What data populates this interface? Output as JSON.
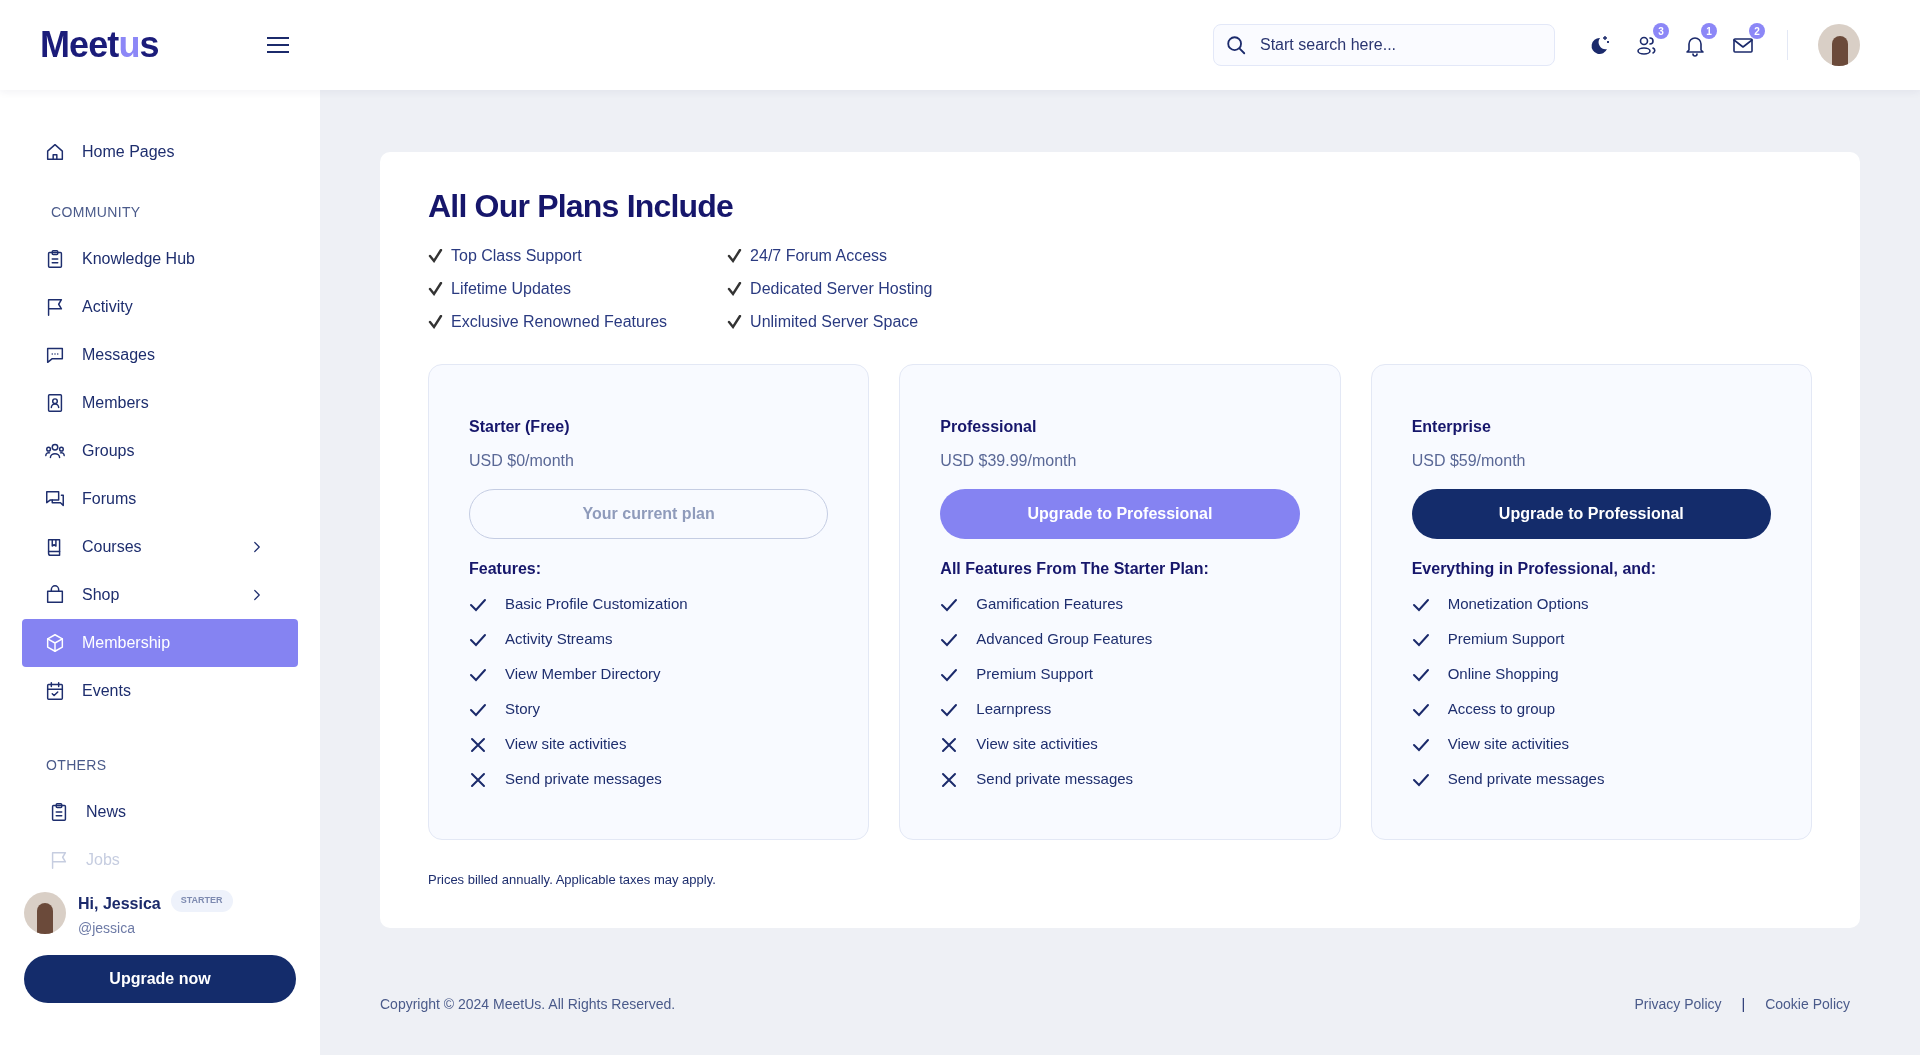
{
  "header": {
    "logo": [
      {
        "text": "Meet",
        "accent": false
      },
      {
        "text": "u",
        "accent": true
      },
      {
        "text": "s",
        "accent": false
      }
    ],
    "search": {
      "placeholder": "Start search here..."
    },
    "icons": [
      {
        "kind": "theme"
      },
      {
        "kind": "friends",
        "badge": "3"
      },
      {
        "kind": "notifications",
        "badge": "1"
      },
      {
        "kind": "messages",
        "badge": "2"
      }
    ]
  },
  "sidebar": {
    "top_items": [
      {
        "label": "Home Pages",
        "selected": false,
        "has_submenu": false
      }
    ],
    "community_heading": "COMMUNITY",
    "community_items": [
      {
        "label": "Knowledge Hub",
        "selected": false,
        "has_submenu": false
      },
      {
        "label": "Activity",
        "selected": false,
        "has_submenu": false
      },
      {
        "label": "Messages",
        "selected": false,
        "has_submenu": false
      },
      {
        "label": "Members",
        "selected": false,
        "has_submenu": false
      },
      {
        "label": "Groups",
        "selected": false,
        "has_submenu": false
      },
      {
        "label": "Forums",
        "selected": false,
        "has_submenu": false
      },
      {
        "label": "Courses",
        "selected": false,
        "has_submenu": true
      },
      {
        "label": "Shop",
        "selected": false,
        "has_submenu": true
      },
      {
        "label": "Membership",
        "selected": true,
        "has_submenu": false
      },
      {
        "label": "Events",
        "selected": false,
        "has_submenu": false
      }
    ],
    "others_heading": "OTHERS",
    "others_items": [
      {
        "label": "News",
        "faded": false
      },
      {
        "label": "Jobs",
        "faded": true
      }
    ],
    "user": {
      "greeting": "Hi, Jessica",
      "badge": "STARTER",
      "handle": "@jessica"
    },
    "upgrade_button": "Upgrade now"
  },
  "main": {
    "title": "All Our Plans Include",
    "includes": [
      [
        "Top Class Support",
        "Lifetime Updates",
        "Exclusive Renowned Features"
      ],
      [
        "24/7 Forum Access",
        "Dedicated Server Hosting",
        "Unlimited Server Space"
      ]
    ],
    "plans": [
      {
        "name": "Starter (Free)",
        "price": "USD $0/month",
        "button": {
          "label": "Your current plan",
          "kind": "current"
        },
        "features_heading": "Features:",
        "features": [
          {
            "text": "Basic Profile Customization",
            "included": true
          },
          {
            "text": "Activity Streams",
            "included": true
          },
          {
            "text": "View Member Directory",
            "included": true
          },
          {
            "text": "Story",
            "included": true
          },
          {
            "text": "View site activities",
            "included": false
          },
          {
            "text": "Send private messages",
            "included": false
          }
        ]
      },
      {
        "name": "Professional",
        "price": "USD $39.99/month",
        "button": {
          "label": "Upgrade to Professional",
          "kind": "primary"
        },
        "features_heading": "All Features From The Starter Plan:",
        "features": [
          {
            "text": "Gamification Features",
            "included": true
          },
          {
            "text": "Advanced Group Features",
            "included": true
          },
          {
            "text": "Premium Support",
            "included": true
          },
          {
            "text": "Learnpress",
            "included": true
          },
          {
            "text": "View site activities",
            "included": false
          },
          {
            "text": "Send private messages",
            "included": false
          }
        ]
      },
      {
        "name": "Enterprise",
        "price": "USD $59/month",
        "button": {
          "label": "Upgrade to Professional",
          "kind": "dark"
        },
        "features_heading": "Everything in Professional, and:",
        "features": [
          {
            "text": "Monetization Options",
            "included": true
          },
          {
            "text": "Premium Support",
            "included": true
          },
          {
            "text": "Online Shopping",
            "included": true
          },
          {
            "text": "Access to group",
            "included": true
          },
          {
            "text": "View site activities",
            "included": true
          },
          {
            "text": "Send private messages",
            "included": true
          }
        ]
      }
    ],
    "note": "Prices billed annually. Applicable taxes may apply."
  },
  "footer": {
    "copyright": "Copyright © 2024 MeetUs. All Rights Reserved.",
    "links": [
      "Privacy Policy",
      "Cookie Policy"
    ],
    "separator": "|"
  }
}
